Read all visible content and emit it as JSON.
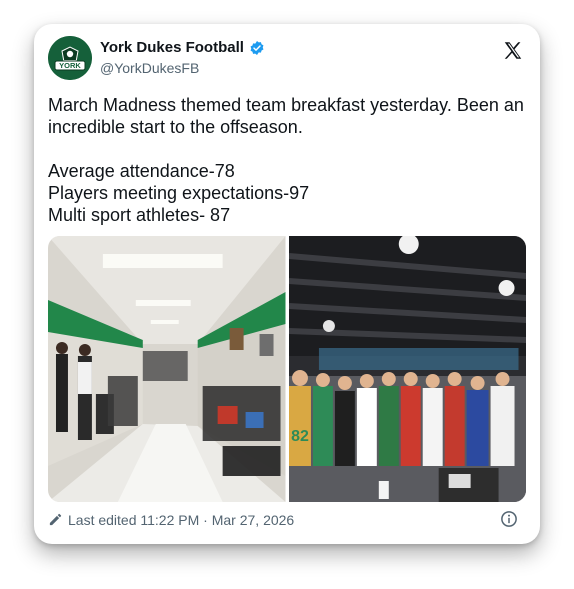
{
  "account": {
    "display_name": "York Dukes Football",
    "handle": "@YorkDukesFB",
    "avatar_text": "YORK",
    "verified": true,
    "platform_logo": "x-logo-icon"
  },
  "tweet": {
    "text": "March Madness themed team breakfast yesterday. Been an incredible start to the offseason.\n\nAverage attendance-78\nPlayers meeting expectations-97\nMulti sport athletes- 87"
  },
  "media": {
    "photos": [
      {
        "description": "hallway-breakfast-photo"
      },
      {
        "description": "team-group-photo",
        "jersey_number": "82"
      }
    ]
  },
  "footer": {
    "edited_label": "Last edited 11:22 PM · Mar 27, 2026",
    "edit_icon": "pencil-icon",
    "info_icon": "info-icon"
  },
  "colors": {
    "verified_blue": "#1d9bf0",
    "secondary_text": "#536471",
    "avatar_green": "#15603a"
  }
}
